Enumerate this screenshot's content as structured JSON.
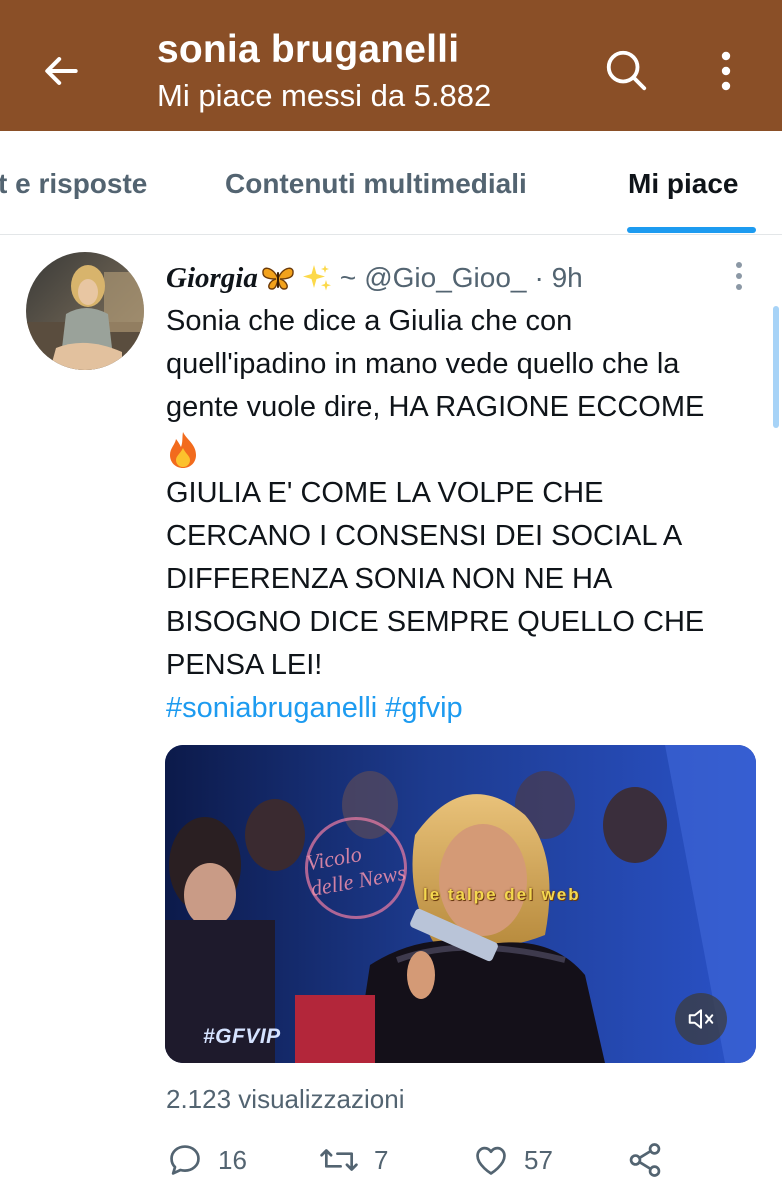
{
  "header": {
    "title": "sonia bruganelli",
    "subtitle": "Mi piace messi da 5.882",
    "background_color": "#8a4f27"
  },
  "tabs": [
    {
      "label": "t e risposte",
      "selected": false
    },
    {
      "label": "Contenuti multimediali",
      "selected": false
    },
    {
      "label": "Mi piace",
      "selected": true
    }
  ],
  "accent_color": "#1d9bf0",
  "tweet": {
    "author_name": "Giorgia",
    "author_emojis": [
      "butterfly-icon",
      "sparkles-icon"
    ],
    "separator": "~",
    "handle": "@Gio_Gioo_",
    "time": "· 9h",
    "text_lines": [
      "Sonia che dice a Giulia che con",
      "quell'ipadino in mano vede quello che la",
      "gente vuole dire, HA RAGIONE ECCOME",
      "",
      "GIULIA E' COME LA VOLPE CHE",
      "CERCANO I CONSENSI DEI SOCIAL A",
      "DIFFERENZA SONIA NON NE HA",
      "BISOGNO  DICE SEMPRE QUELLO CHE",
      "PENSA LEI!"
    ],
    "fire_emoji": "fire-icon",
    "hashtags": "#soniabruganelli #gfvip",
    "media": {
      "type": "video",
      "overlay_logo": "#GFVIP",
      "watermark_left": "Vicolo delle News",
      "watermark_right": "le talpe del web",
      "muted": true
    },
    "views": "2.123 visualizzazioni",
    "stats": {
      "replies": "16",
      "retweets": "7",
      "likes": "57"
    }
  }
}
